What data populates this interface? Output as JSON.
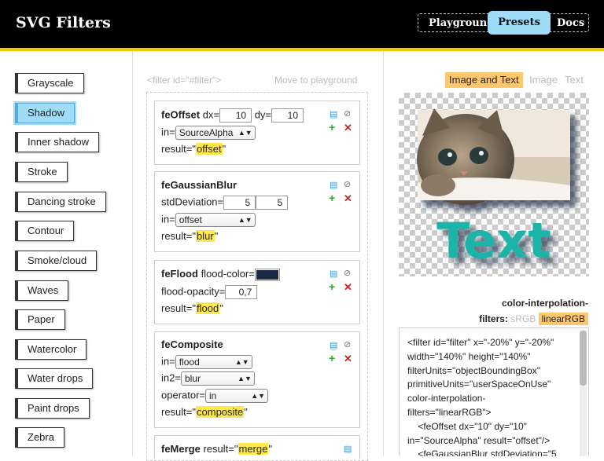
{
  "app": {
    "title": "SVG Filters"
  },
  "nav": {
    "items": [
      "Playground",
      "Presets",
      "Docs"
    ],
    "active": "Presets"
  },
  "presets": [
    "Grayscale",
    "Shadow",
    "Inner shadow",
    "Stroke",
    "Dancing stroke",
    "Contour",
    "Smoke/cloud",
    "Waves",
    "Paper",
    "Watercolor",
    "Water drops",
    "Paint drops",
    "Zebra"
  ],
  "active_preset": "Shadow",
  "middle": {
    "filter_id_label": "<filter id=\"#filter\">",
    "move_label": "Move to playground"
  },
  "primitives": {
    "offset": {
      "name": "feOffset",
      "dx_label": "dx=",
      "dx": "10",
      "dy_label": "dy=",
      "dy": "10",
      "in_label": "in=",
      "in": "SourceAlpha",
      "result_label": "result=",
      "result": "offset"
    },
    "blur": {
      "name": "feGaussianBlur",
      "std_label": "stdDeviation=",
      "std_x": "5",
      "std_y": "5",
      "in_label": "in=",
      "in": "offset",
      "result_label": "result=",
      "result": "blur"
    },
    "flood": {
      "name": "feFlood",
      "color_label": "flood-color=",
      "color": "#1a2a44",
      "opacity_label": "flood-opacity=",
      "opacity": "0,7",
      "result_label": "result=",
      "result": "flood"
    },
    "composite": {
      "name": "feComposite",
      "in_label": "in=",
      "in": "flood",
      "in2_label": "in2=",
      "in2": "blur",
      "operator_label": "operator=",
      "operator": "in",
      "result_label": "result=",
      "result": "composite"
    },
    "merge": {
      "name": "feMerge",
      "result_label": "result=",
      "result": "merge"
    }
  },
  "preview": {
    "tabs": [
      "Image and Text",
      "Image",
      "Text"
    ],
    "active_tab": "Image and Text",
    "sample_text": "Text"
  },
  "color_interp": {
    "label": "color-interpolation-filters:",
    "options": [
      "sRGB",
      "linearRGB"
    ],
    "active": "linearRGB"
  },
  "code": "<filter id=\"filter\" x=\"-20%\" y=\"-20%\"\nwidth=\"140%\" height=\"140%\"\nfilterUnits=\"objectBoundingBox\"\nprimitiveUnits=\"userSpaceOnUse\"\ncolor-interpolation-\nfilters=\"linearRGB\">\n    <feOffset dx=\"10\" dy=\"10\"\nin=\"SourceAlpha\" result=\"offset\"/>\n    <feGaussianBlur stdDeviation=\"5",
  "colors": {
    "accent_yellow": "#f5c800",
    "active_blue": "#9edcf8",
    "highlight": "#ffe94a",
    "tab_orange": "#ffc870",
    "text_teal": "#1bb3a8"
  }
}
